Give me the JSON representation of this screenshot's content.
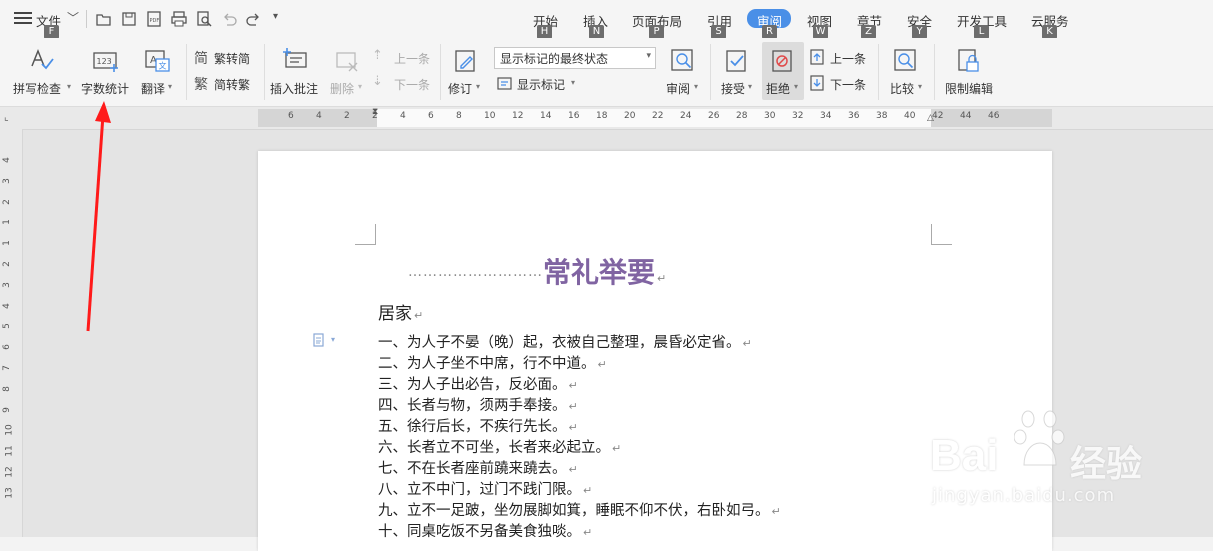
{
  "menubar": {
    "file_label": "文件",
    "file_key": "F",
    "tabs": [
      {
        "label": "开始",
        "key": "H"
      },
      {
        "label": "插入",
        "key": "N"
      },
      {
        "label": "页面布局",
        "key": "P"
      },
      {
        "label": "引用",
        "key": "S"
      },
      {
        "label": "审阅",
        "key": "R"
      },
      {
        "label": "视图",
        "key": "W"
      },
      {
        "label": "章节",
        "key": "Z"
      },
      {
        "label": "安全",
        "key": "Y"
      },
      {
        "label": "开发工具",
        "key": "L"
      },
      {
        "label": "云服务",
        "key": "K"
      }
    ],
    "active_tab": "审阅"
  },
  "ribbon": {
    "spellcheck": "拼写检查",
    "wordcount": "字数统计",
    "translate": "翻译",
    "trad_to_simp": "繁转简",
    "simp_to_trad": "简转繁",
    "insert_comment": "插入批注",
    "delete": "删除",
    "prev_comment": "上一条",
    "next_comment": "下一条",
    "track_changes": "修订",
    "display_select": "显示标记的最终状态",
    "show_markup": "显示标记",
    "review_pane": "审阅",
    "accept": "接受",
    "reject": "拒绝",
    "prev_change": "上一条",
    "next_change": "下一条",
    "compare": "比较",
    "restrict_editing": "限制编辑"
  },
  "ruler": {
    "horizontal_ticks": [
      "6",
      "4",
      "2",
      "2",
      "4",
      "6",
      "8",
      "10",
      "12",
      "14",
      "16",
      "18",
      "20",
      "22",
      "24",
      "26",
      "28",
      "30",
      "32",
      "34",
      "36",
      "38",
      "40",
      "42",
      "44",
      "46"
    ],
    "vertical_ticks": [
      "4",
      "3",
      "2",
      "1",
      "1",
      "2",
      "3",
      "4",
      "5",
      "6",
      "7",
      "8",
      "9",
      "10",
      "11",
      "12",
      "13"
    ]
  },
  "document": {
    "title": "常礼举要",
    "heading": "居家",
    "lines": [
      "一、为人子不晏（晚）起，衣被自己整理，晨昏必定省。",
      "二、为人子坐不中席，行不中道。",
      "三、为人子出必告，反必面。",
      "四、长者与物，须两手奉接。",
      "五、徐行后长，不疾行先长。",
      "六、长者立不可坐，长者来必起立。",
      "七、不在长者座前蹺来蹺去。",
      "八、立不中门，过门不践门限。",
      "九、立不一足跛，坐勿展脚如箕，睡眠不仰不伏，右卧如弓。",
      "十、同桌吃饭不另备美食独啖。"
    ]
  },
  "watermark": {
    "brand": "Bai",
    "brand_cn": "经验",
    "url": "jingyan.baidu.com"
  },
  "colors": {
    "accent": "#4a8fe7",
    "title": "#8064a2",
    "arrow": "#ff1a1a",
    "badge": "#6d6d6d"
  }
}
